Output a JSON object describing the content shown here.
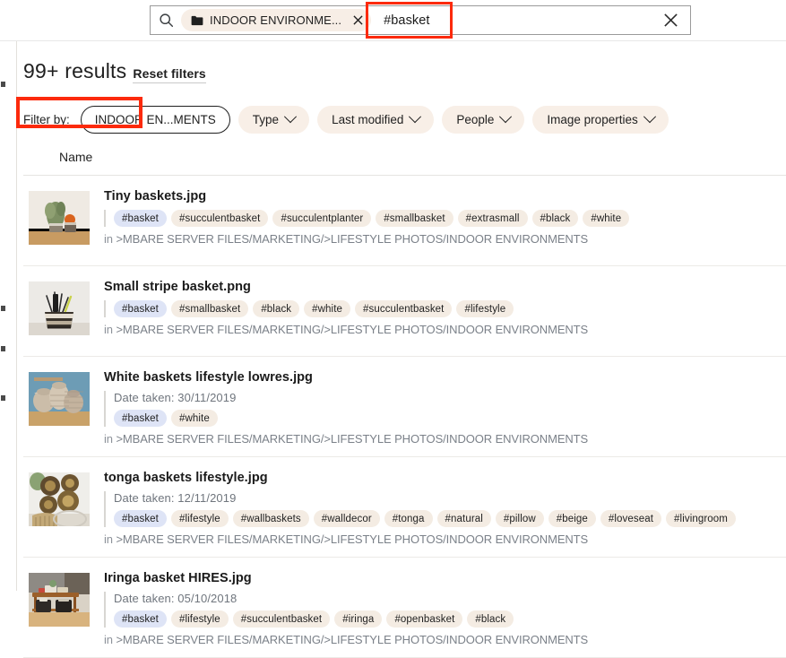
{
  "search": {
    "search_icon": "search-icon",
    "folder_chip": {
      "icon": "folder-icon",
      "label": "INDOOR ENVIRONME...",
      "remove_label": "✕"
    },
    "query": "#basket",
    "clear_label": "✕",
    "highlight_color": "#fc2a0c"
  },
  "results": {
    "count_label": "99+ results",
    "reset_label": "Reset filters"
  },
  "filters": {
    "label": "Filter by:",
    "chips": [
      {
        "label": "INDOOR EN...MENTS",
        "active": true,
        "caret": false
      },
      {
        "label": "Type",
        "active": false,
        "caret": true
      },
      {
        "label": "Last modified",
        "active": false,
        "caret": true
      },
      {
        "label": "People",
        "active": false,
        "caret": true
      },
      {
        "label": "Image properties",
        "active": false,
        "caret": true
      }
    ]
  },
  "table": {
    "column_header": "Name",
    "path_prefix": "in ",
    "rows": [
      {
        "name": "Tiny baskets.jpg",
        "date_taken": "",
        "tags": [
          "#basket",
          "#succulentbasket",
          "#succulentplanter",
          "#smallbasket",
          "#extrasmall",
          "#black",
          "#white"
        ],
        "match_tag": "#basket",
        "path": ">MBARE SERVER FILES/MARKETING/>LIFESTYLE PHOTOS/INDOOR ENVIRONMENTS",
        "thumb": "tiny-baskets-thumb"
      },
      {
        "name": "Small stripe basket.png",
        "date_taken": "",
        "tags": [
          "#basket",
          "#smallbasket",
          "#black",
          "#white",
          "#succulentbasket",
          "#lifestyle"
        ],
        "match_tag": "#basket",
        "path": ">MBARE SERVER FILES/MARKETING/>LIFESTYLE PHOTOS/INDOOR ENVIRONMENTS",
        "thumb": "small-stripe-basket-thumb"
      },
      {
        "name": "White baskets lifestyle lowres.jpg",
        "date_taken": "Date taken: 30/11/2019",
        "tags": [
          "#basket",
          "#white"
        ],
        "match_tag": "#basket",
        "path": ">MBARE SERVER FILES/MARKETING/>LIFESTYLE PHOTOS/INDOOR ENVIRONMENTS",
        "thumb": "white-baskets-thumb"
      },
      {
        "name": "tonga baskets lifestyle.jpg",
        "date_taken": "Date taken: 12/11/2019",
        "tags": [
          "#basket",
          "#lifestyle",
          "#wallbaskets",
          "#walldecor",
          "#tonga",
          "#natural",
          "#pillow",
          "#beige",
          "#loveseat",
          "#livingroom"
        ],
        "match_tag": "#basket",
        "path": ">MBARE SERVER FILES/MARKETING/>LIFESTYLE PHOTOS/INDOOR ENVIRONMENTS",
        "thumb": "tonga-baskets-thumb"
      },
      {
        "name": "Iringa basket HIRES.jpg",
        "date_taken": "Date taken: 05/10/2018",
        "tags": [
          "#basket",
          "#lifestyle",
          "#succulentbasket",
          "#iringa",
          "#openbasket",
          "#black"
        ],
        "match_tag": "#basket",
        "path": ">MBARE SERVER FILES/MARKETING/>LIFESTYLE PHOTOS/INDOOR ENVIRONMENTS",
        "thumb": "iringa-basket-thumb"
      }
    ]
  },
  "colors": {
    "tag_default_bg": "#f4ece3",
    "tag_match_bg": "#dee4f6",
    "chip_bg": "#f8efe7",
    "path_text": "#7b8189",
    "highlight": "#fc2a0c"
  }
}
